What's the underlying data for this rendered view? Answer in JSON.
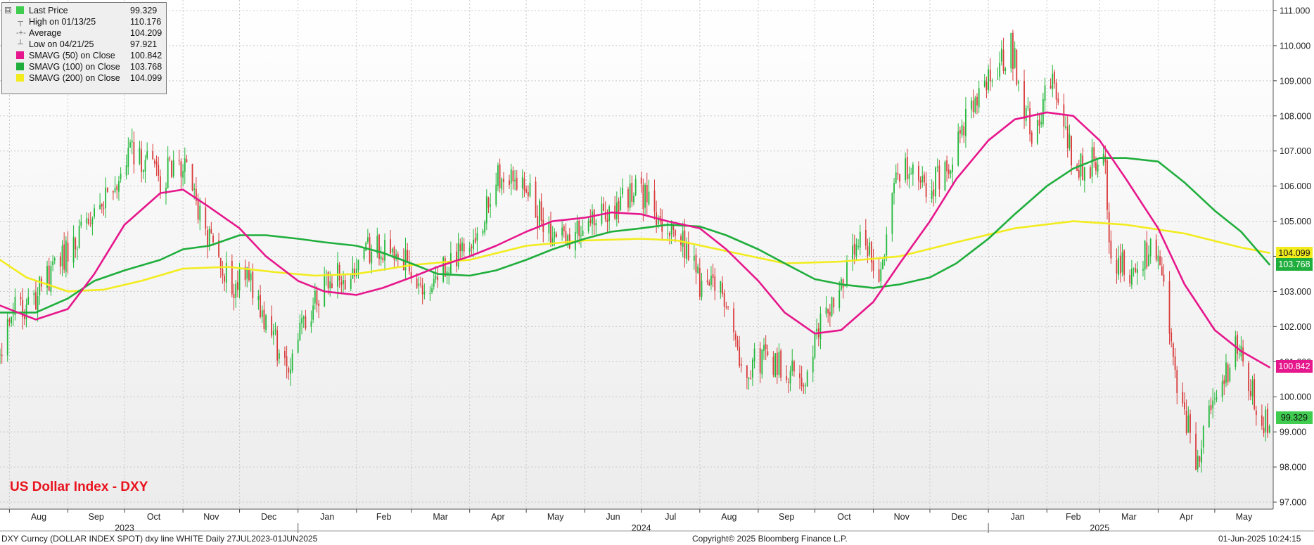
{
  "colors": {
    "up": "#22b83a",
    "down": "#d93a3a",
    "sma50": "#e6178c",
    "sma100": "#1fae3c",
    "sma200": "#f2ec1f",
    "grid": "#c8c8c8",
    "title": "#e8141e"
  },
  "legend": {
    "collapse_glyph": "⊟",
    "rows": [
      {
        "label": "Last Price",
        "value": "99.329",
        "icon": "green-square",
        "color": "#3fcc4f"
      },
      {
        "label": "High on 01/13/25",
        "value": "110.176",
        "icon": "high-marker",
        "glyph": "┬"
      },
      {
        "label": "Average",
        "value": "104.209",
        "icon": "average-marker",
        "glyph": "-+-"
      },
      {
        "label": "Low on 04/21/25",
        "value": "97.921",
        "icon": "low-marker",
        "glyph": "┴"
      },
      {
        "label": "SMAVG (50)  on Close",
        "value": "100.842",
        "icon": "magenta-square",
        "color": "#e6178c"
      },
      {
        "label": "SMAVG (100)  on Close",
        "value": "103.768",
        "icon": "green-square",
        "color": "#1fae3c"
      },
      {
        "label": "SMAVG (200)  on Close",
        "value": "104.099",
        "icon": "yellow-square",
        "color": "#f2ec1f"
      }
    ]
  },
  "title": "US Dollar Index - DXY",
  "footer": {
    "left": "DXY Curncy (DOLLAR INDEX SPOT) dxy line WHITE  Daily 27JUL2023-01JUN2025",
    "center": "Copyright© 2025 Bloomberg Finance L.P.",
    "right": "01-Jun-2025 10:24:15"
  },
  "tags": {
    "sma200": "104.099",
    "sma100": "103.768",
    "sma50": "100.842",
    "last": "99.329"
  },
  "chart_data": {
    "type": "candlestick-with-moving-averages",
    "title": "US Dollar Index - DXY",
    "period": "Daily 27JUL2023-01JUN2025",
    "y_axis": {
      "side": "right",
      "ylim": [
        96.8,
        111.3
      ],
      "ticks": [
        "97.000",
        "98.000",
        "99.000",
        "100.000",
        "101.000",
        "102.000",
        "103.000",
        "104.000",
        "105.000",
        "106.000",
        "107.000",
        "108.000",
        "109.000",
        "110.000",
        "111.000"
      ]
    },
    "x_axis": {
      "months": [
        {
          "label": "Aug",
          "date": "2023-08-01"
        },
        {
          "label": "Sep",
          "date": "2023-09-01"
        },
        {
          "label": "Oct",
          "date": "2023-10-01"
        },
        {
          "label": "Nov",
          "date": "2023-11-01"
        },
        {
          "label": "Dec",
          "date": "2023-12-01"
        },
        {
          "label": "Jan",
          "date": "2024-01-01"
        },
        {
          "label": "Feb",
          "date": "2024-02-01"
        },
        {
          "label": "Mar",
          "date": "2024-03-01"
        },
        {
          "label": "Apr",
          "date": "2024-04-01"
        },
        {
          "label": "May",
          "date": "2024-05-01"
        },
        {
          "label": "Jun",
          "date": "2024-06-01"
        },
        {
          "label": "Jul",
          "date": "2024-07-01"
        },
        {
          "label": "Aug",
          "date": "2024-08-01"
        },
        {
          "label": "Sep",
          "date": "2024-09-01"
        },
        {
          "label": "Oct",
          "date": "2024-10-01"
        },
        {
          "label": "Nov",
          "date": "2024-11-01"
        },
        {
          "label": "Dec",
          "date": "2024-12-01"
        },
        {
          "label": "Jan",
          "date": "2025-01-01"
        },
        {
          "label": "Feb",
          "date": "2025-02-01"
        },
        {
          "label": "Mar",
          "date": "2025-03-01"
        },
        {
          "label": "Apr",
          "date": "2025-04-01"
        },
        {
          "label": "May",
          "date": "2025-05-01"
        }
      ],
      "years": [
        {
          "label": "2023",
          "date": "2023-10-01"
        },
        {
          "label": "2024",
          "date": "2024-07-01"
        },
        {
          "label": "2025",
          "date": "2025-03-01"
        }
      ],
      "year_separators": [
        "2024-01-01",
        "2025-01-01"
      ],
      "range": [
        "2023-07-27",
        "2025-06-01"
      ]
    },
    "grid": true,
    "legend_position": "top-left",
    "price_path": [
      [
        "2023-07-27",
        101.2
      ],
      [
        "2023-08-03",
        102.4
      ],
      [
        "2023-08-10",
        102.6
      ],
      [
        "2023-08-22",
        103.4
      ],
      [
        "2023-09-01",
        104.1
      ],
      [
        "2023-09-12",
        104.8
      ],
      [
        "2023-09-22",
        105.6
      ],
      [
        "2023-10-03",
        107.0
      ],
      [
        "2023-10-12",
        106.6
      ],
      [
        "2023-10-20",
        106.2
      ],
      [
        "2023-10-31",
        106.7
      ],
      [
        "2023-11-08",
        105.6
      ],
      [
        "2023-11-17",
        104.1
      ],
      [
        "2023-11-28",
        103.0
      ],
      [
        "2023-12-05",
        103.8
      ],
      [
        "2023-12-14",
        102.0
      ],
      [
        "2023-12-27",
        100.9
      ],
      [
        "2024-01-05",
        102.2
      ],
      [
        "2024-01-17",
        103.4
      ],
      [
        "2024-01-30",
        103.4
      ],
      [
        "2024-02-08",
        104.2
      ],
      [
        "2024-02-21",
        104.0
      ],
      [
        "2024-03-01",
        103.8
      ],
      [
        "2024-03-08",
        102.8
      ],
      [
        "2024-03-20",
        103.8
      ],
      [
        "2024-04-01",
        104.6
      ],
      [
        "2024-04-10",
        105.3
      ],
      [
        "2024-04-16",
        106.3
      ],
      [
        "2024-04-30",
        106.0
      ],
      [
        "2024-05-15",
        104.4
      ],
      [
        "2024-05-28",
        104.6
      ],
      [
        "2024-06-07",
        105.0
      ],
      [
        "2024-06-21",
        105.6
      ],
      [
        "2024-07-01",
        105.9
      ],
      [
        "2024-07-11",
        104.8
      ],
      [
        "2024-07-24",
        104.3
      ],
      [
        "2024-08-02",
        103.1
      ],
      [
        "2024-08-15",
        102.9
      ],
      [
        "2024-08-23",
        100.8
      ],
      [
        "2024-09-05",
        101.2
      ],
      [
        "2024-09-17",
        100.8
      ],
      [
        "2024-09-27",
        100.4
      ],
      [
        "2024-10-04",
        102.2
      ],
      [
        "2024-10-15",
        103.2
      ],
      [
        "2024-10-25",
        104.3
      ],
      [
        "2024-11-05",
        103.6
      ],
      [
        "2024-11-14",
        106.6
      ],
      [
        "2024-11-27",
        106.0
      ],
      [
        "2024-12-06",
        106.2
      ],
      [
        "2024-12-20",
        107.8
      ],
      [
        "2025-01-02",
        109.0
      ],
      [
        "2025-01-13",
        110.0
      ],
      [
        "2025-01-24",
        107.4
      ],
      [
        "2025-02-03",
        109.0
      ],
      [
        "2025-02-14",
        107.0
      ],
      [
        "2025-02-21",
        106.4
      ],
      [
        "2025-03-03",
        107.2
      ],
      [
        "2025-03-07",
        103.9
      ],
      [
        "2025-03-18",
        103.5
      ],
      [
        "2025-03-28",
        104.2
      ],
      [
        "2025-04-04",
        103.1
      ],
      [
        "2025-04-11",
        100.1
      ],
      [
        "2025-04-21",
        98.3
      ],
      [
        "2025-04-30",
        99.6
      ],
      [
        "2025-05-12",
        101.5
      ],
      [
        "2025-05-22",
        99.9
      ],
      [
        "2025-05-28",
        99.2
      ],
      [
        "2025-05-30",
        99.33
      ]
    ],
    "high_marker": {
      "date": "2025-01-13",
      "value": 110.176
    },
    "low_marker": {
      "date": "2025-04-21",
      "value": 97.921
    },
    "series": [
      {
        "name": "SMAVG (50)  on Close",
        "color": "#e6178c",
        "last": 100.842,
        "points": [
          [
            "2023-07-27",
            102.6
          ],
          [
            "2023-08-15",
            102.2
          ],
          [
            "2023-09-01",
            102.5
          ],
          [
            "2023-09-15",
            103.5
          ],
          [
            "2023-10-01",
            104.9
          ],
          [
            "2023-10-20",
            105.8
          ],
          [
            "2023-11-01",
            105.9
          ],
          [
            "2023-11-15",
            105.4
          ],
          [
            "2023-12-01",
            104.8
          ],
          [
            "2023-12-15",
            104.0
          ],
          [
            "2024-01-01",
            103.3
          ],
          [
            "2024-01-15",
            103.0
          ],
          [
            "2024-02-01",
            102.9
          ],
          [
            "2024-02-15",
            103.1
          ],
          [
            "2024-03-01",
            103.4
          ],
          [
            "2024-03-15",
            103.7
          ],
          [
            "2024-04-01",
            104.0
          ],
          [
            "2024-04-15",
            104.3
          ],
          [
            "2024-05-01",
            104.7
          ],
          [
            "2024-05-15",
            105.0
          ],
          [
            "2024-06-01",
            105.1
          ],
          [
            "2024-06-15",
            105.25
          ],
          [
            "2024-07-01",
            105.2
          ],
          [
            "2024-07-15",
            105.0
          ],
          [
            "2024-08-01",
            104.8
          ],
          [
            "2024-08-15",
            104.2
          ],
          [
            "2024-09-01",
            103.3
          ],
          [
            "2024-09-15",
            102.4
          ],
          [
            "2024-10-01",
            101.8
          ],
          [
            "2024-10-15",
            101.9
          ],
          [
            "2024-11-01",
            102.7
          ],
          [
            "2024-11-15",
            103.8
          ],
          [
            "2024-12-01",
            105.0
          ],
          [
            "2024-12-15",
            106.2
          ],
          [
            "2025-01-01",
            107.3
          ],
          [
            "2025-01-15",
            107.9
          ],
          [
            "2025-02-01",
            108.1
          ],
          [
            "2025-02-15",
            108.0
          ],
          [
            "2025-03-01",
            107.3
          ],
          [
            "2025-03-15",
            106.2
          ],
          [
            "2025-04-01",
            104.8
          ],
          [
            "2025-04-15",
            103.2
          ],
          [
            "2025-05-01",
            101.9
          ],
          [
            "2025-05-15",
            101.3
          ],
          [
            "2025-05-30",
            100.842
          ]
        ]
      },
      {
        "name": "SMAVG (100)  on Close",
        "color": "#1fae3c",
        "last": 103.768,
        "points": [
          [
            "2023-07-27",
            102.4
          ],
          [
            "2023-08-15",
            102.4
          ],
          [
            "2023-09-01",
            102.8
          ],
          [
            "2023-09-15",
            103.3
          ],
          [
            "2023-10-01",
            103.6
          ],
          [
            "2023-10-20",
            103.9
          ],
          [
            "2023-11-01",
            104.2
          ],
          [
            "2023-11-15",
            104.3
          ],
          [
            "2023-12-01",
            104.6
          ],
          [
            "2023-12-15",
            104.6
          ],
          [
            "2024-01-01",
            104.5
          ],
          [
            "2024-01-15",
            104.4
          ],
          [
            "2024-02-01",
            104.3
          ],
          [
            "2024-02-15",
            104.1
          ],
          [
            "2024-03-01",
            103.8
          ],
          [
            "2024-03-15",
            103.5
          ],
          [
            "2024-04-01",
            103.45
          ],
          [
            "2024-04-15",
            103.6
          ],
          [
            "2024-05-01",
            103.9
          ],
          [
            "2024-05-15",
            104.2
          ],
          [
            "2024-06-01",
            104.5
          ],
          [
            "2024-06-15",
            104.7
          ],
          [
            "2024-07-01",
            104.8
          ],
          [
            "2024-07-15",
            104.9
          ],
          [
            "2024-08-01",
            104.85
          ],
          [
            "2024-08-15",
            104.6
          ],
          [
            "2024-09-01",
            104.2
          ],
          [
            "2024-09-15",
            103.8
          ],
          [
            "2024-10-01",
            103.35
          ],
          [
            "2024-10-15",
            103.2
          ],
          [
            "2024-11-01",
            103.1
          ],
          [
            "2024-11-15",
            103.2
          ],
          [
            "2024-12-01",
            103.4
          ],
          [
            "2024-12-15",
            103.8
          ],
          [
            "2025-01-01",
            104.5
          ],
          [
            "2025-01-15",
            105.2
          ],
          [
            "2025-02-01",
            106.0
          ],
          [
            "2025-02-15",
            106.5
          ],
          [
            "2025-03-01",
            106.8
          ],
          [
            "2025-03-15",
            106.8
          ],
          [
            "2025-04-01",
            106.7
          ],
          [
            "2025-04-15",
            106.1
          ],
          [
            "2025-05-01",
            105.3
          ],
          [
            "2025-05-15",
            104.7
          ],
          [
            "2025-05-30",
            103.768
          ]
        ]
      },
      {
        "name": "SMAVG (200)  on Close",
        "color": "#f2ec1f",
        "last": 104.099,
        "points": [
          [
            "2023-07-27",
            103.9
          ],
          [
            "2023-08-10",
            103.4
          ],
          [
            "2023-09-01",
            103.0
          ],
          [
            "2023-09-20",
            103.05
          ],
          [
            "2023-10-10",
            103.3
          ],
          [
            "2023-11-01",
            103.65
          ],
          [
            "2023-11-25",
            103.7
          ],
          [
            "2023-12-20",
            103.55
          ],
          [
            "2024-01-10",
            103.45
          ],
          [
            "2024-02-01",
            103.5
          ],
          [
            "2024-03-01",
            103.75
          ],
          [
            "2024-04-01",
            103.9
          ],
          [
            "2024-05-01",
            104.3
          ],
          [
            "2024-06-01",
            104.45
          ],
          [
            "2024-07-01",
            104.5
          ],
          [
            "2024-07-20",
            104.45
          ],
          [
            "2024-08-15",
            104.15
          ],
          [
            "2024-09-15",
            103.8
          ],
          [
            "2024-10-15",
            103.85
          ],
          [
            "2024-11-15",
            104.0
          ],
          [
            "2024-12-15",
            104.4
          ],
          [
            "2025-01-15",
            104.8
          ],
          [
            "2025-02-15",
            105.0
          ],
          [
            "2025-03-15",
            104.9
          ],
          [
            "2025-04-15",
            104.65
          ],
          [
            "2025-05-15",
            104.25
          ],
          [
            "2025-05-30",
            104.099
          ]
        ]
      }
    ]
  }
}
